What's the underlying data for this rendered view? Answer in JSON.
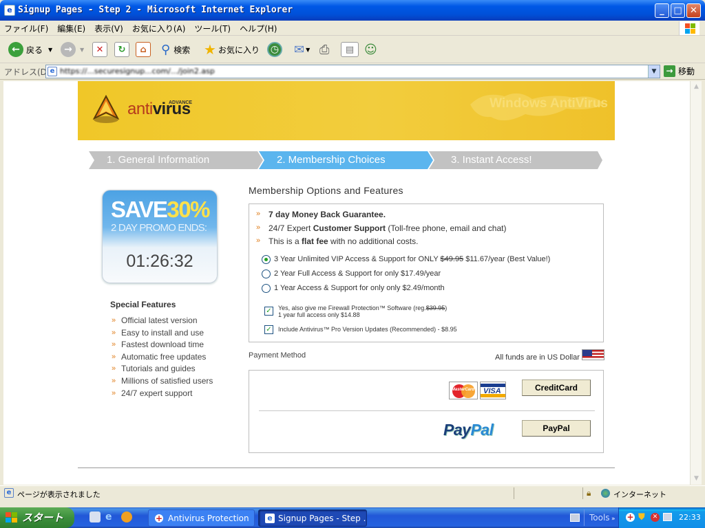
{
  "window": {
    "title": "Signup Pages - Step 2 - Microsoft Internet Explorer",
    "buttons": {
      "minimize": "_",
      "maximize": "□",
      "close": "✕"
    }
  },
  "menu": [
    "ファイル(F)",
    "編集(E)",
    "表示(V)",
    "お気に入り(A)",
    "ツール(T)",
    "ヘルプ(H)"
  ],
  "toolbar": {
    "back_label": "戻る",
    "search_label": "検索",
    "favorites_label": "お気に入り"
  },
  "address": {
    "label": "アドレス(D)",
    "url": "https://...securesignup...com/.../join2.asp",
    "go_label": "移動"
  },
  "page": {
    "banner": {
      "logo_advance": "ADVANCE",
      "logo_anti": "anti",
      "logo_virus": "virus",
      "watermark": "Windows AntiVirus"
    },
    "steps": [
      {
        "label": "1. General Information",
        "color": "#C2C2C2"
      },
      {
        "label": "2. Membership Choices",
        "color": "#5BB5EE"
      },
      {
        "label": "3. Instant Access!",
        "color": "#C2C2C2"
      }
    ],
    "promo": {
      "save": "SAVE",
      "percent": "30%",
      "ends": "2 DAY PROMO ENDS:",
      "timer": "01:26:32"
    },
    "special_features": {
      "title": "Special Features",
      "items": [
        "Official latest version",
        "Easy to install and use",
        "Fastest download time",
        "Automatic free updates",
        "Tutorials and guides",
        "Millions of satisfied users",
        "24/7 expert support"
      ]
    },
    "membership": {
      "title": "Membership Options and Features",
      "feature1": "7 day Money Back Guarantee.",
      "feature2_pre": "24/7 Expert ",
      "feature2_bold": "Customer Support",
      "feature2_post": " (Toll-free phone, email and chat)",
      "feature3_pre": "This is a ",
      "feature3_bold": "flat fee",
      "feature3_post": " with no additional costs.",
      "plan1_pre": "3 Year Unlimited VIP Access & Support for ONLY ",
      "plan1_old": "$49.95",
      "plan1_post": " $11.67/year (Best Value!)",
      "plan2": "2 Year Full Access & Support for only $17.49/year",
      "plan3": "1 Year Access & Support for only only $2.49/month",
      "selected_plan": 1,
      "addon1_pre": "Yes, also give me Firewall Protection™ Software (reg.",
      "addon1_old": "$39.95",
      "addon1_post": ")",
      "addon1_line2": "1 year full access only $14.88",
      "addon2": "Include Antivirus™ Pro Version Updates (Recommended) - $8.95"
    },
    "payment": {
      "label": "Payment Method",
      "funds": "All funds are in US Dollar",
      "mastercard_text": "MasterCard",
      "visa_text": "VISA",
      "creditcard_button": "CreditCard",
      "paypal_logo_pay": "Pay",
      "paypal_logo_pal": "Pal",
      "paypal_button": "PayPal"
    }
  },
  "status": {
    "text": "ページが表示されました",
    "zone": "インターネット"
  },
  "taskbar": {
    "start": "スタート",
    "tasks": [
      "Antivirus Protection",
      "Signup Pages - Step ..."
    ],
    "tools": "Tools",
    "clock": "22:33"
  }
}
